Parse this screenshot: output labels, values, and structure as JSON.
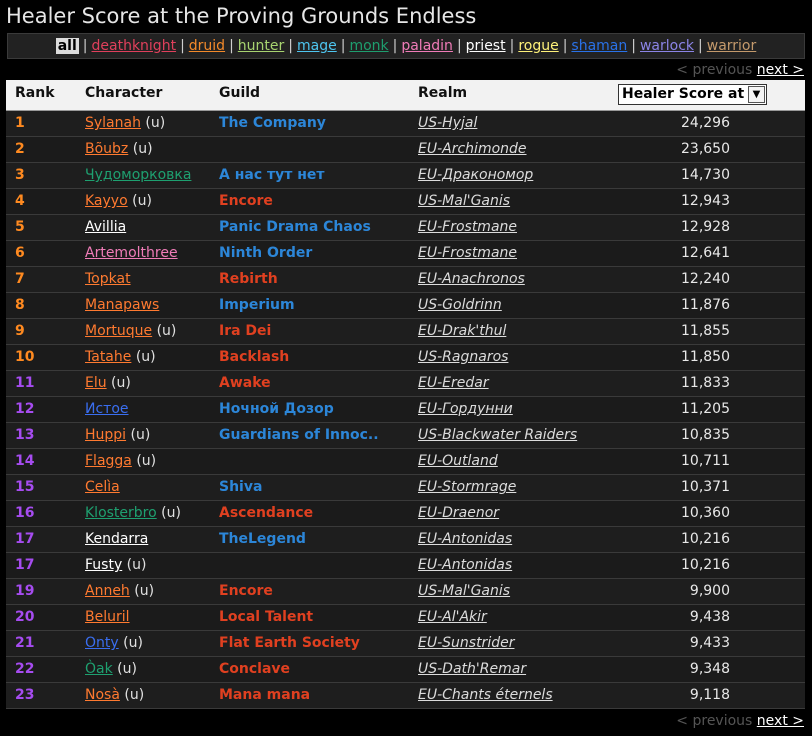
{
  "title": "Healer Score at the Proving Grounds Endless",
  "classes": [
    {
      "label": "all",
      "color": "#000000",
      "active": true
    },
    {
      "label": "deathknight",
      "color": "#e0405c"
    },
    {
      "label": "druid",
      "color": "#f48a2a"
    },
    {
      "label": "hunter",
      "color": "#a8d470"
    },
    {
      "label": "mage",
      "color": "#4ec6f0"
    },
    {
      "label": "monk",
      "color": "#1e9e6e"
    },
    {
      "label": "paladin",
      "color": "#f07cb8"
    },
    {
      "label": "priest",
      "color": "#ffffff"
    },
    {
      "label": "rogue",
      "color": "#fff27a"
    },
    {
      "label": "shaman",
      "color": "#2a72e8"
    },
    {
      "label": "warlock",
      "color": "#8b84e6"
    },
    {
      "label": "warrior",
      "color": "#c49a6c"
    }
  ],
  "pager": {
    "previous": "< previous",
    "next": "next >"
  },
  "headers": {
    "rank": "Rank",
    "character": "Character",
    "guild": "Guild",
    "realm": "Realm",
    "score_select": "Healer Score at"
  },
  "rows": [
    {
      "rank": "1",
      "rank_color": "#ff8a20",
      "name": "Sylanah",
      "name_color": "#ff7a30",
      "tag": " (u)",
      "guild": "The Company",
      "guild_color": "#2c86d8",
      "realm": "US-Hyjal",
      "score": "24,296"
    },
    {
      "rank": "2",
      "rank_color": "#ff8a20",
      "name": "Bõubz",
      "name_color": "#ff7a30",
      "tag": " (u)",
      "guild": "",
      "guild_color": "#2c86d8",
      "realm": "EU-Archimonde",
      "score": "23,650"
    },
    {
      "rank": "3",
      "rank_color": "#ff8a20",
      "name": "Чудоморковка",
      "name_color": "#1ea070",
      "tag": "",
      "guild": "А нас тут нет",
      "guild_color": "#2c86d8",
      "realm": "EU-Дракономор",
      "score": "14,730"
    },
    {
      "rank": "4",
      "rank_color": "#ff8a20",
      "name": "Kayyo",
      "name_color": "#ff7a30",
      "tag": " (u)",
      "guild": "Encore",
      "guild_color": "#e04020",
      "realm": "US-Mal'Ganis",
      "score": "12,943"
    },
    {
      "rank": "5",
      "rank_color": "#ff8a20",
      "name": "Avillia",
      "name_color": "#ffffff",
      "tag": "",
      "guild": "Panic Drama Chaos",
      "guild_color": "#2c86d8",
      "realm": "EU-Frostmane",
      "score": "12,928"
    },
    {
      "rank": "6",
      "rank_color": "#ff8a20",
      "name": "Artemolthree",
      "name_color": "#f07cb8",
      "tag": "",
      "guild": "Ninth Order",
      "guild_color": "#2c86d8",
      "realm": "EU-Frostmane",
      "score": "12,641"
    },
    {
      "rank": "7",
      "rank_color": "#ff8a20",
      "name": "Topkat",
      "name_color": "#ff7a30",
      "tag": "",
      "guild": "Rebirth",
      "guild_color": "#e04020",
      "realm": "EU-Anachronos",
      "score": "12,240"
    },
    {
      "rank": "8",
      "rank_color": "#ff8a20",
      "name": "Manapaws",
      "name_color": "#ff7a30",
      "tag": "",
      "guild": "Imperium",
      "guild_color": "#2c86d8",
      "realm": "US-Goldrinn",
      "score": "11,876"
    },
    {
      "rank": "9",
      "rank_color": "#ff8a20",
      "name": "Mortuque",
      "name_color": "#ff7a30",
      "tag": " (u)",
      "guild": "Ira Dei",
      "guild_color": "#e04020",
      "realm": "EU-Drak'thul",
      "score": "11,855"
    },
    {
      "rank": "10",
      "rank_color": "#ff8a20",
      "name": "Tatahe",
      "name_color": "#ff7a30",
      "tag": " (u)",
      "guild": "Backlash",
      "guild_color": "#e04020",
      "realm": "US-Ragnaros",
      "score": "11,850"
    },
    {
      "rank": "11",
      "rank_color": "#a64cf0",
      "name": "Elu",
      "name_color": "#ff7a30",
      "tag": " (u)",
      "guild": "Awake",
      "guild_color": "#e04020",
      "realm": "EU-Eredar",
      "score": "11,833"
    },
    {
      "rank": "12",
      "rank_color": "#a64cf0",
      "name": "Истое",
      "name_color": "#3a6ef0",
      "tag": "",
      "guild": "Ночной Дозор",
      "guild_color": "#2c86d8",
      "realm": "EU-Гордунни",
      "score": "11,205"
    },
    {
      "rank": "13",
      "rank_color": "#a64cf0",
      "name": "Huppi",
      "name_color": "#ff7a30",
      "tag": " (u)",
      "guild": "Guardians of Innoc..",
      "guild_color": "#2c86d8",
      "realm": "US-Blackwater Raiders",
      "score": "10,835"
    },
    {
      "rank": "14",
      "rank_color": "#a64cf0",
      "name": "Flagga",
      "name_color": "#ff7a30",
      "tag": " (u)",
      "guild": "",
      "guild_color": "#2c86d8",
      "realm": "EU-Outland",
      "score": "10,711"
    },
    {
      "rank": "15",
      "rank_color": "#a64cf0",
      "name": "Celìa",
      "name_color": "#ff7a30",
      "tag": "",
      "guild": "Shiva",
      "guild_color": "#2c86d8",
      "realm": "EU-Stormrage",
      "score": "10,371"
    },
    {
      "rank": "16",
      "rank_color": "#a64cf0",
      "name": "Klosterbro",
      "name_color": "#1ea070",
      "tag": " (u)",
      "guild": "Ascendance",
      "guild_color": "#e04020",
      "realm": "EU-Draenor",
      "score": "10,360"
    },
    {
      "rank": "17",
      "rank_color": "#a64cf0",
      "name": "Kendarra",
      "name_color": "#ffffff",
      "tag": "",
      "guild": "TheLegend",
      "guild_color": "#2c86d8",
      "realm": "EU-Antonidas",
      "score": "10,216"
    },
    {
      "rank": "17",
      "rank_color": "#a64cf0",
      "name": "Fusty",
      "name_color": "#ffffff",
      "tag": " (u)",
      "guild": "",
      "guild_color": "#2c86d8",
      "realm": "EU-Antonidas",
      "score": "10,216"
    },
    {
      "rank": "19",
      "rank_color": "#a64cf0",
      "name": "Anneh",
      "name_color": "#ff7a30",
      "tag": " (u)",
      "guild": "Encore",
      "guild_color": "#e04020",
      "realm": "US-Mal'Ganis",
      "score": "9,900"
    },
    {
      "rank": "20",
      "rank_color": "#a64cf0",
      "name": "Beluril",
      "name_color": "#ff7a30",
      "tag": "",
      "guild": "Local Talent",
      "guild_color": "#e04020",
      "realm": "EU-Al'Akir",
      "score": "9,438"
    },
    {
      "rank": "21",
      "rank_color": "#a64cf0",
      "name": "Onty",
      "name_color": "#3a6ef0",
      "tag": " (u)",
      "guild": "Flat Earth Society",
      "guild_color": "#e04020",
      "realm": "EU-Sunstrider",
      "score": "9,433"
    },
    {
      "rank": "22",
      "rank_color": "#a64cf0",
      "name": "Òak",
      "name_color": "#1ea070",
      "tag": " (u)",
      "guild": "Conclave",
      "guild_color": "#e04020",
      "realm": "US-Dath'Remar",
      "score": "9,348"
    },
    {
      "rank": "23",
      "rank_color": "#a64cf0",
      "name": "Nosà",
      "name_color": "#ff7a30",
      "tag": " (u)",
      "guild": "Mana mana",
      "guild_color": "#e04020",
      "realm": "EU-Chants éternels",
      "score": "9,118"
    }
  ]
}
